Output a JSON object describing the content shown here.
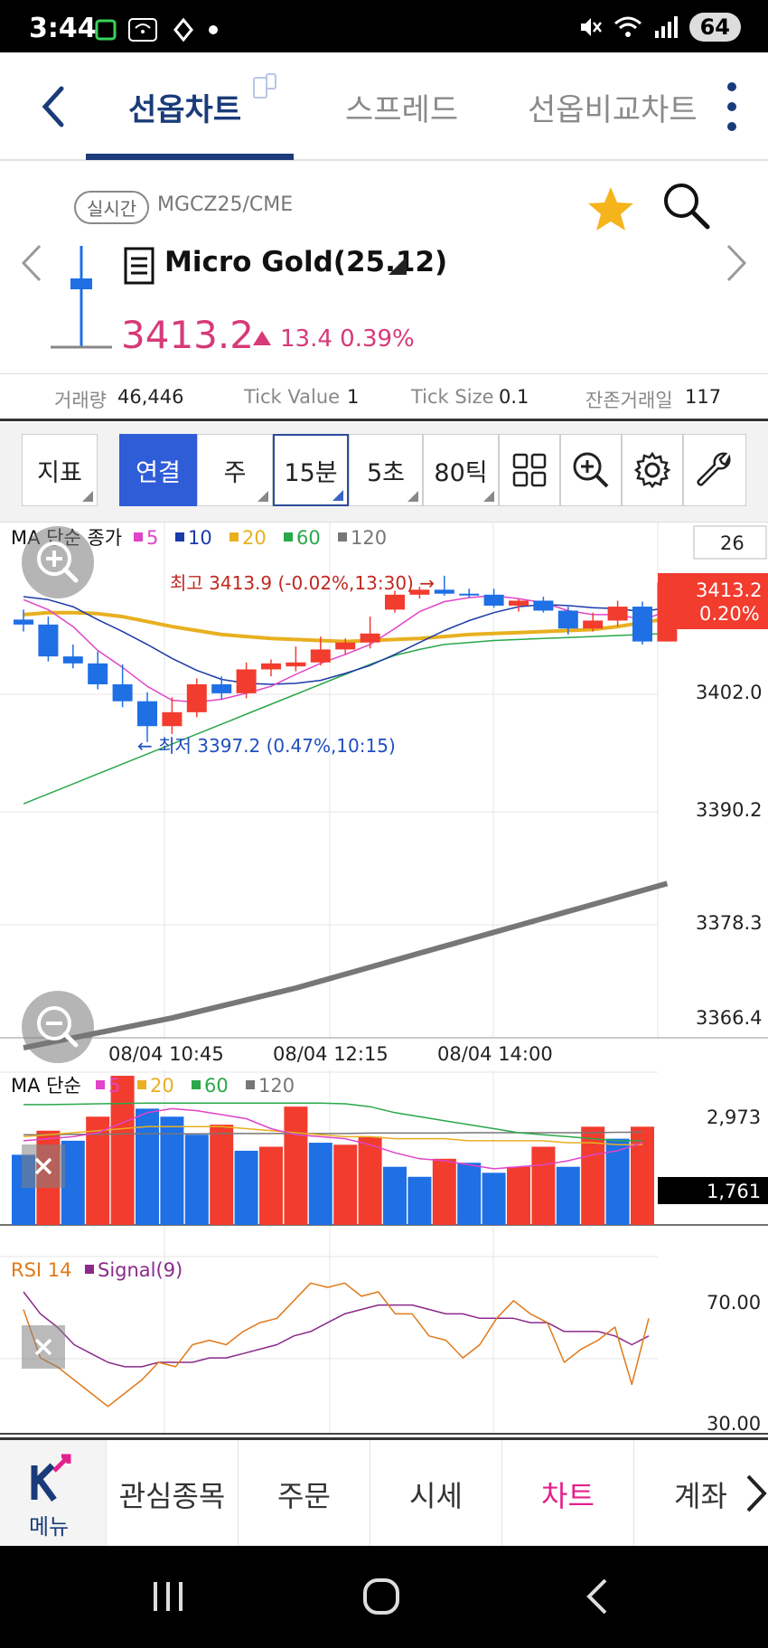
{
  "status": {
    "time": "3:44",
    "battery": "64"
  },
  "nav": {
    "tabs": [
      {
        "label": "선옵차트",
        "active": true
      },
      {
        "label": "스프레드",
        "active": false
      },
      {
        "label": "선옵비교차트",
        "active": false
      }
    ]
  },
  "symbol": {
    "realtime_badge": "실시간",
    "code": "MGCZ25/CME",
    "name": "Micro Gold(25.12)",
    "price": "3413.2",
    "change": "13.4",
    "change_pct": "0.39%"
  },
  "info": {
    "volume_label": "거래량",
    "volume": "46,446",
    "tick_value_label": "Tick Value",
    "tick_value": "1",
    "tick_size_label": "Tick Size",
    "tick_size": "0.1",
    "days_left_label": "잔존거래일",
    "days_left": "117"
  },
  "toolbar": {
    "indicator": "지표",
    "continuous": "연결",
    "week": "주",
    "min15": "15분",
    "sec5": "5초",
    "tick80": "80틱"
  },
  "colors": {
    "up": "#f23c2e",
    "down": "#1f6fe5",
    "accent": "#1d3b7b",
    "pink": "#d63a78"
  },
  "chart_data": [
    {
      "type": "candlestick",
      "title": "MA 단순 종가",
      "legend": [
        {
          "name": "5",
          "color": "#e044c8"
        },
        {
          "name": "10",
          "color": "#1a3aa8"
        },
        {
          "name": "20",
          "color": "#e8b020"
        },
        {
          "name": "60",
          "color": "#2aa84a"
        },
        {
          "name": "120",
          "color": "#777777"
        }
      ],
      "count_box": "26",
      "y_ticks": [
        "3402.0",
        "3390.2",
        "3378.3",
        "3366.4"
      ],
      "x_ticks": [
        "08/04 10:45",
        "08/04 12:15",
        "08/04 14:00"
      ],
      "current_price_tag": {
        "price": "3413.2",
        "pct": "0.20%"
      },
      "high_annotation": "최고 3413.9 (-0.02%,13:30) →",
      "low_annotation": "← 최저 3397.2 (0.47%,10:15)",
      "candles": [
        [
          3409.5,
          3410.5,
          3408.3,
          3409.0
        ],
        [
          3409.0,
          3409.8,
          3405.3,
          3405.8
        ],
        [
          3405.8,
          3407.0,
          3404.6,
          3405.1
        ],
        [
          3405.1,
          3406.3,
          3402.5,
          3403.0
        ],
        [
          3403.0,
          3405.0,
          3400.7,
          3401.3
        ],
        [
          3401.3,
          3402.2,
          3397.2,
          3398.8
        ],
        [
          3398.8,
          3401.7,
          3398.0,
          3400.2
        ],
        [
          3400.2,
          3403.6,
          3399.7,
          3403.0
        ],
        [
          3403.0,
          3403.8,
          3401.5,
          3402.1
        ],
        [
          3402.1,
          3405.2,
          3401.6,
          3404.5
        ],
        [
          3404.5,
          3405.5,
          3403.8,
          3405.1
        ],
        [
          3404.8,
          3406.8,
          3404.3,
          3405.2
        ],
        [
          3405.2,
          3407.8,
          3404.9,
          3406.5
        ],
        [
          3406.5,
          3407.6,
          3406.0,
          3407.2
        ],
        [
          3407.2,
          3409.8,
          3406.6,
          3408.1
        ],
        [
          3410.5,
          3412.4,
          3410.2,
          3412.0
        ],
        [
          3412.0,
          3412.8,
          3411.6,
          3412.5
        ],
        [
          3412.5,
          3413.9,
          3411.9,
          3412.1
        ],
        [
          3412.1,
          3412.6,
          3411.7,
          3412.0
        ],
        [
          3412.0,
          3412.6,
          3410.7,
          3410.9
        ],
        [
          3410.9,
          3411.6,
          3410.3,
          3411.4
        ],
        [
          3411.4,
          3411.8,
          3410.2,
          3410.4
        ],
        [
          3410.4,
          3410.8,
          3408.0,
          3408.6
        ],
        [
          3408.6,
          3410.2,
          3408.3,
          3409.4
        ],
        [
          3409.4,
          3411.4,
          3408.8,
          3410.8
        ],
        [
          3410.8,
          3411.3,
          3407.0,
          3407.3
        ],
        [
          3407.3,
          3413.7,
          3407.3,
          3413.2
        ]
      ],
      "ma5": [
        3411.5,
        3410.5,
        3408.8,
        3406.4,
        3404.7,
        3402.8,
        3401.4,
        3401.2,
        3401.5,
        3402.1,
        3402.8,
        3404.0,
        3405.1,
        3406.0,
        3407.0,
        3408.6,
        3410.3,
        3411.3,
        3411.7,
        3411.9,
        3411.6,
        3411.2,
        3410.4,
        3410.0,
        3410.0,
        3409.5,
        3410.3
      ],
      "ma10": [
        3411.8,
        3411.5,
        3410.8,
        3409.5,
        3408.3,
        3407.0,
        3405.6,
        3404.4,
        3403.5,
        3403.1,
        3403.0,
        3403.1,
        3403.4,
        3404.1,
        3404.9,
        3406.0,
        3407.2,
        3408.4,
        3409.4,
        3410.2,
        3410.8,
        3411.0,
        3410.9,
        3410.7,
        3410.6,
        3410.3,
        3410.7
      ],
      "ma20": [
        3410.0,
        3410.2,
        3410.2,
        3410.1,
        3409.8,
        3409.3,
        3408.8,
        3408.4,
        3408.0,
        3407.8,
        3407.6,
        3407.5,
        3407.4,
        3407.3,
        3407.4,
        3407.5,
        3407.6,
        3407.8,
        3408.0,
        3408.1,
        3408.2,
        3408.3,
        3408.4,
        3408.5,
        3408.8,
        3409.2,
        3409.6
      ],
      "ma60": [
        3391.0,
        3392.0,
        3393.0,
        3394.0,
        3395.0,
        3396.0,
        3397.0,
        3398.0,
        3399.0,
        3400.0,
        3401.0,
        3402.0,
        3403.0,
        3404.0,
        3405.0,
        3405.9,
        3406.5,
        3407.0,
        3407.2,
        3407.4,
        3407.5,
        3407.6,
        3407.7,
        3407.8,
        3407.9,
        3408.0,
        3408.1
      ],
      "ma120": [
        3366.5,
        3367.0,
        3367.5,
        3368.0,
        3368.5,
        3369.0,
        3369.5,
        3370.1,
        3370.7,
        3371.3,
        3371.9,
        3372.5,
        3373.2,
        3373.9,
        3374.6,
        3375.3,
        3376.0,
        3376.7,
        3377.4,
        3378.1,
        3378.8,
        3379.5,
        3380.2,
        3380.9,
        3381.6,
        3382.3,
        3383.0
      ]
    },
    {
      "type": "bar",
      "title": "MA 단순",
      "legend": [
        {
          "name": "5",
          "color": "#e044c8"
        },
        {
          "name": "20",
          "color": "#e8b020"
        },
        {
          "name": "60",
          "color": "#2aa84a"
        },
        {
          "name": "120",
          "color": "#777777"
        }
      ],
      "y_ticks": [
        "2,973"
      ],
      "current_value_tag": "1,761",
      "volumes": [
        1750,
        2350,
        2100,
        2700,
        3720,
        2900,
        2700,
        2250,
        2500,
        1850,
        1950,
        2950,
        2050,
        2000,
        2200,
        1450,
        1200,
        1650,
        1550,
        1300,
        1450,
        1950,
        1450,
        2450,
        2150,
        2450
      ],
      "volume_dirs": [
        "down",
        "up",
        "down",
        "up",
        "up",
        "down",
        "down",
        "down",
        "up",
        "down",
        "up",
        "up",
        "down",
        "up",
        "up",
        "down",
        "down",
        "up",
        "down",
        "down",
        "up",
        "up",
        "down",
        "up",
        "down",
        "up"
      ],
      "vma5": [
        2100,
        2150,
        2200,
        2300,
        2550,
        2800,
        2900,
        2850,
        2750,
        2650,
        2400,
        2250,
        2200,
        2150,
        2000,
        1800,
        1650,
        1600,
        1500,
        1400,
        1450,
        1500,
        1600,
        1750,
        1850,
        2050
      ],
      "vma20": [
        2200,
        2250,
        2300,
        2350,
        2400,
        2450,
        2450,
        2450,
        2450,
        2400,
        2350,
        2300,
        2250,
        2200,
        2200,
        2150,
        2150,
        2150,
        2100,
        2100,
        2100,
        2100,
        2050,
        2050,
        2000,
        2000
      ],
      "vma60": [
        3000,
        3000,
        3010,
        3020,
        3030,
        3040,
        3040,
        3040,
        3040,
        3040,
        3040,
        3040,
        3040,
        3020,
        2950,
        2800,
        2700,
        2600,
        2500,
        2400,
        2300,
        2250,
        2200,
        2150,
        2100,
        2100
      ],
      "vma120": [
        2250,
        2250,
        2260,
        2260,
        2270,
        2270,
        2270,
        2270,
        2280,
        2280,
        2280,
        2280,
        2280,
        2280,
        2290,
        2290,
        2290,
        2290,
        2300,
        2300,
        2300,
        2300,
        2300,
        2300,
        2310,
        2310
      ]
    },
    {
      "type": "line",
      "title": "RSI 14",
      "legend": [
        {
          "name": "RSI 14",
          "color": "#e07a1a"
        },
        {
          "name": "Signal(9)",
          "color": "#8a2a8a"
        }
      ],
      "y_ticks": [
        "70.00",
        "30.00"
      ],
      "ylim": [
        30,
        70
      ],
      "rsi": [
        58,
        47,
        45,
        42,
        39,
        36,
        39,
        42,
        46,
        45,
        50,
        51,
        50,
        53,
        55,
        56,
        60,
        64,
        63,
        64,
        61,
        62,
        57,
        57,
        52,
        51,
        47,
        50,
        56,
        60,
        57,
        55,
        46,
        49,
        51,
        54,
        41,
        56
      ],
      "signal": [
        62,
        57,
        54,
        50,
        48,
        46,
        45,
        45,
        46,
        46,
        46,
        47,
        47,
        48,
        49,
        50,
        52,
        53,
        55,
        57,
        58,
        59,
        59,
        59,
        58,
        57,
        57,
        56,
        56,
        56,
        55,
        55,
        53,
        53,
        53,
        52,
        50,
        52
      ]
    }
  ],
  "bottom_nav": {
    "menu": "메뉴",
    "items": [
      {
        "label": "관심종목",
        "active": false
      },
      {
        "label": "주문",
        "active": false
      },
      {
        "label": "시세",
        "active": false
      },
      {
        "label": "차트",
        "active": true
      },
      {
        "label": "계좌",
        "active": false
      }
    ]
  }
}
